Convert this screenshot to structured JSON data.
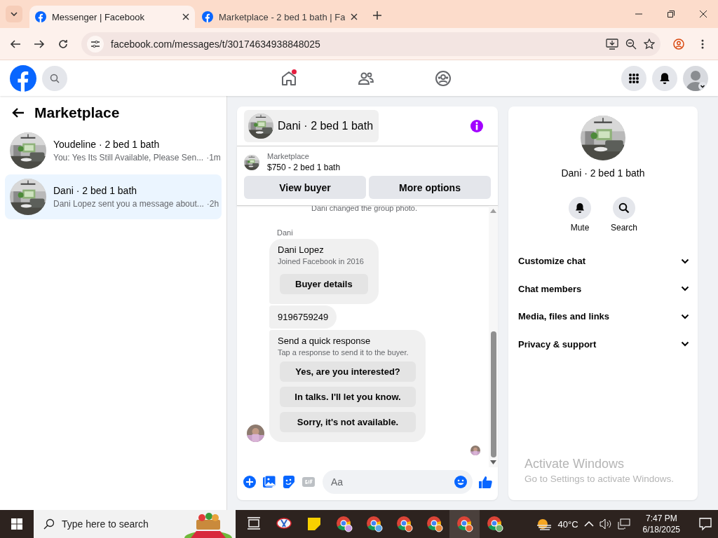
{
  "browser": {
    "tabs": [
      {
        "title": "Messenger | Facebook",
        "selected": true
      },
      {
        "title": "Marketplace - 2 bed 1 bath | Fa",
        "selected": false
      }
    ],
    "address": "facebook.com/messages/t/30174634938848025"
  },
  "top_nav": [
    {
      "kind": "home",
      "badge": true
    },
    {
      "kind": "friends",
      "badge": false
    },
    {
      "kind": "groups",
      "badge": false
    }
  ],
  "sidebar": {
    "title": "Marketplace",
    "conversations": [
      {
        "title": "Youdeline · 2 bed 1 bath",
        "preview": "You: Yes Its Still Available, Please Sen...",
        "time": "·1m",
        "selected": false
      },
      {
        "title": "Dani · 2 bed 1 bath",
        "preview": "Dani Lopez sent you a message about...",
        "time": "·2h",
        "selected": true
      }
    ]
  },
  "chat": {
    "title": "Dani · 2 bed 1 bath",
    "listing": {
      "label": "Marketplace",
      "title": "$750 - 2 bed 1 bath"
    },
    "buttons": [
      "View buyer",
      "More options"
    ],
    "system_message": "Dani changed the group photo.",
    "sender": "Dani",
    "profile_card": {
      "name": "Dani Lopez",
      "subtitle": "Joined Facebook in 2016",
      "button": "Buyer details"
    },
    "phone_message": "9196759249",
    "quick_response": {
      "title": "Send a quick response",
      "subtitle": "Tap a response to send it to the buyer.",
      "options": [
        "Yes, are you interested?",
        "In talks. I'll let you know.",
        "Sorry, it's not available."
      ]
    },
    "composer": {
      "placeholder": "Aa"
    }
  },
  "details": {
    "name": "Dani · 2 bed 1 bath",
    "actions": [
      {
        "label": "Mute",
        "kind": "mute"
      },
      {
        "label": "Search",
        "kind": "search"
      }
    ],
    "sections": [
      "Customize chat",
      "Chat members",
      "Media, files and links",
      "Privacy & support"
    ]
  },
  "activation": {
    "title": "Activate Windows",
    "subtitle": "Go to Settings to activate Windows."
  },
  "taskbar": {
    "search_placeholder": "Type here to search",
    "weather": "40°C",
    "time": "7:47 PM",
    "date": "6/18/2025"
  }
}
